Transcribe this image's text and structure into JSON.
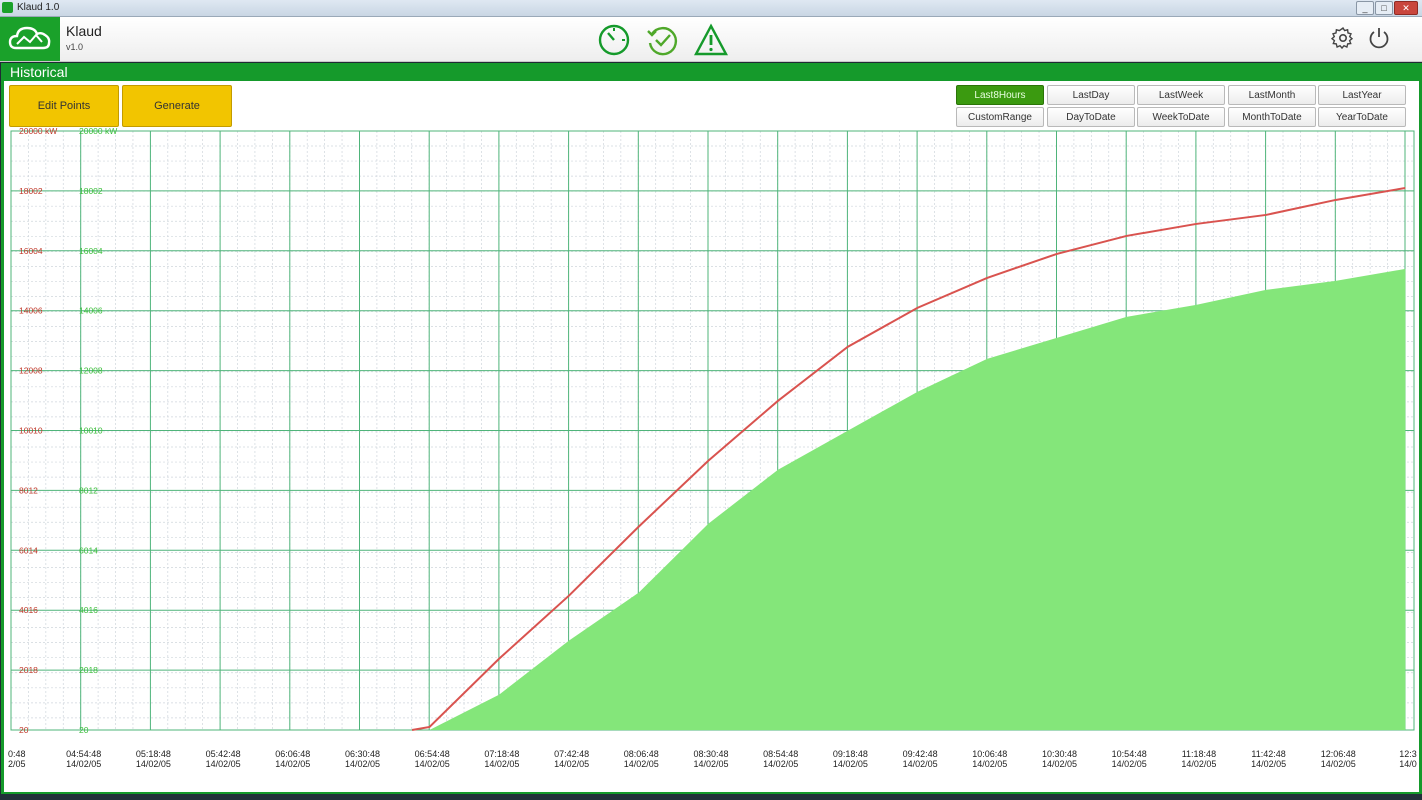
{
  "window": {
    "title": "Klaud 1.0",
    "buttons": [
      "_",
      "□",
      "✕"
    ]
  },
  "header": {
    "app_name": "Klaud",
    "version": "v1.0",
    "icons": [
      "gauge-icon",
      "history-check-icon",
      "warning-icon",
      "settings-icon",
      "power-icon"
    ]
  },
  "panel": {
    "title": "Historical"
  },
  "toolbar": {
    "edit_points": "Edit Points",
    "generate": "Generate"
  },
  "ranges": [
    {
      "label": "Last8Hours",
      "active": true
    },
    {
      "label": "LastDay",
      "active": false
    },
    {
      "label": "LastWeek",
      "active": false
    },
    {
      "label": "LastMonth",
      "active": false
    },
    {
      "label": "LastYear",
      "active": false
    },
    {
      "label": "CustomRange",
      "active": false
    },
    {
      "label": "DayToDate",
      "active": false
    },
    {
      "label": "WeekToDate",
      "active": false
    },
    {
      "label": "MonthToDate",
      "active": false
    },
    {
      "label": "YearToDate",
      "active": false
    }
  ],
  "colors": {
    "brand": "#159a2b",
    "accent": "#f2c500",
    "line": "#d9534f",
    "area": "#84e67a",
    "grid": "#4fb47a"
  },
  "chart_data": {
    "type": "area",
    "ylim": [
      20,
      20000
    ],
    "y_ticks": [
      "20",
      "2018",
      "4016",
      "6014",
      "8012",
      "10010",
      "12008",
      "14006",
      "16004",
      "18002",
      "20000 kW"
    ],
    "x_labels": [
      {
        "time": "0:48",
        "date": "2/05"
      },
      {
        "time": "04:54:48",
        "date": "14/02/05"
      },
      {
        "time": "05:18:48",
        "date": "14/02/05"
      },
      {
        "time": "05:42:48",
        "date": "14/02/05"
      },
      {
        "time": "06:06:48",
        "date": "14/02/05"
      },
      {
        "time": "06:30:48",
        "date": "14/02/05"
      },
      {
        "time": "06:54:48",
        "date": "14/02/05"
      },
      {
        "time": "07:18:48",
        "date": "14/02/05"
      },
      {
        "time": "07:42:48",
        "date": "14/02/05"
      },
      {
        "time": "08:06:48",
        "date": "14/02/05"
      },
      {
        "time": "08:30:48",
        "date": "14/02/05"
      },
      {
        "time": "08:54:48",
        "date": "14/02/05"
      },
      {
        "time": "09:18:48",
        "date": "14/02/05"
      },
      {
        "time": "09:42:48",
        "date": "14/02/05"
      },
      {
        "time": "10:06:48",
        "date": "14/02/05"
      },
      {
        "time": "10:30:48",
        "date": "14/02/05"
      },
      {
        "time": "10:54:48",
        "date": "14/02/05"
      },
      {
        "time": "11:18:48",
        "date": "14/02/05"
      },
      {
        "time": "11:42:48",
        "date": "14/02/05"
      },
      {
        "time": "12:06:48",
        "date": "14/02/05"
      },
      {
        "time": "12:3",
        "date": "14/0"
      }
    ],
    "series": [
      {
        "type": "line",
        "x": [
          "06:48:48",
          "06:54:48",
          "07:18:48",
          "07:42:48",
          "08:06:48",
          "08:30:48",
          "08:54:48",
          "09:18:48",
          "09:42:48",
          "10:06:48",
          "10:30:48",
          "10:54:48",
          "11:18:48",
          "11:42:48",
          "12:06:48",
          "12:30:48"
        ],
        "values": [
          20,
          120,
          2400,
          4500,
          6800,
          9000,
          11000,
          12800,
          14100,
          15100,
          15900,
          16500,
          16900,
          17200,
          17700,
          18100
        ]
      },
      {
        "type": "area",
        "x": [
          "06:54:48",
          "07:18:48",
          "07:42:48",
          "08:06:48",
          "08:30:48",
          "08:54:48",
          "09:18:48",
          "09:42:48",
          "10:06:48",
          "10:30:48",
          "10:54:48",
          "11:18:48",
          "11:42:48",
          "12:06:48",
          "12:30:48"
        ],
        "values": [
          20,
          1200,
          3000,
          4600,
          6900,
          8700,
          10000,
          11300,
          12400,
          13100,
          13800,
          14200,
          14700,
          15000,
          15400
        ]
      }
    ]
  }
}
